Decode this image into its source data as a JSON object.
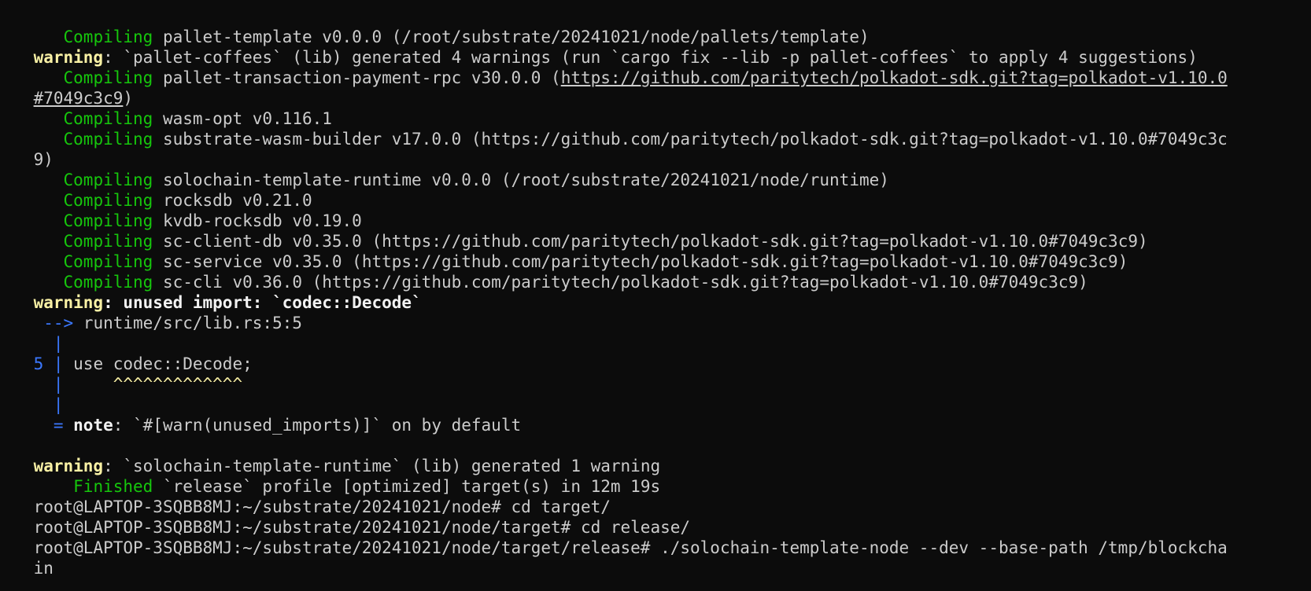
{
  "terminal": {
    "lines": [
      {
        "prefix": "   ",
        "keyword": "Compiling",
        "text": " pallet-template v0.0.0 (/root/substrate/20241021/node/pallets/template)"
      },
      {
        "warning": "warning",
        "text": ": `pallet-coffees` (lib) generated 4 warnings (run `cargo fix --lib -p pallet-coffees` to apply 4 suggestions)"
      },
      {
        "prefix": "   ",
        "keyword": "Compiling",
        "text_before": " pallet-transaction-payment-rpc v30.0.0 (",
        "link": "https://github.com/paritytech/polkadot-sdk.git?tag=polkadot-v1.10.0"
      },
      {
        "link": "#7049c3c9",
        "text": ")"
      },
      {
        "prefix": "   ",
        "keyword": "Compiling",
        "text": " wasm-opt v0.116.1"
      },
      {
        "prefix": "   ",
        "keyword": "Compiling",
        "text": " substrate-wasm-builder v17.0.0 (https://github.com/paritytech/polkadot-sdk.git?tag=polkadot-v1.10.0#7049c3c"
      },
      {
        "text": "9)"
      },
      {
        "prefix": "   ",
        "keyword": "Compiling",
        "text": " solochain-template-runtime v0.0.0 (/root/substrate/20241021/node/runtime)"
      },
      {
        "prefix": "   ",
        "keyword": "Compiling",
        "text": " rocksdb v0.21.0"
      },
      {
        "prefix": "   ",
        "keyword": "Compiling",
        "text": " kvdb-rocksdb v0.19.0"
      },
      {
        "prefix": "   ",
        "keyword": "Compiling",
        "text": " sc-client-db v0.35.0 (https://github.com/paritytech/polkadot-sdk.git?tag=polkadot-v1.10.0#7049c3c9)"
      },
      {
        "prefix": "   ",
        "keyword": "Compiling",
        "text": " sc-service v0.35.0 (https://github.com/paritytech/polkadot-sdk.git?tag=polkadot-v1.10.0#7049c3c9)"
      },
      {
        "prefix": "   ",
        "keyword": "Compiling",
        "text": " sc-cli v0.36.0 (https://github.com/paritytech/polkadot-sdk.git?tag=polkadot-v1.10.0#7049c3c9)"
      },
      {
        "warning": "warning",
        "bold": ": unused import: `codec::Decode`"
      },
      {
        "arrow": " -->",
        "text": " runtime/src/lib.rs:5:5"
      },
      {
        "gutter": "  |"
      },
      {
        "gutter": "5 |",
        "text": " use codec::Decode;"
      },
      {
        "gutter": "  |",
        "caret": "     ^^^^^^^^^^^^^"
      },
      {
        "gutter": "  |"
      },
      {
        "gutter": "  =",
        "note": " note",
        "text": ": `#[warn(unused_imports)]` on by default"
      },
      {
        "text": ""
      },
      {
        "warning": "warning",
        "text": ": `solochain-template-runtime` (lib) generated 1 warning"
      },
      {
        "prefix": "    ",
        "keyword": "Finished",
        "text": " `release` profile [optimized] target(s) in 12m 19s"
      },
      {
        "text": "root@LAPTOP-3SQBB8MJ:~/substrate/20241021/node# cd target/"
      },
      {
        "text": "root@LAPTOP-3SQBB8MJ:~/substrate/20241021/node/target# cd release/"
      },
      {
        "text": "root@LAPTOP-3SQBB8MJ:~/substrate/20241021/node/target/release# ./solochain-template-node --dev --base-path /tmp/blockcha"
      },
      {
        "text": "in"
      }
    ]
  },
  "colors": {
    "background": "#0c0c0c",
    "foreground": "#cccccc",
    "green": "#16c60c",
    "yellow": "#f9f1a5",
    "blue": "#3b78ff"
  }
}
